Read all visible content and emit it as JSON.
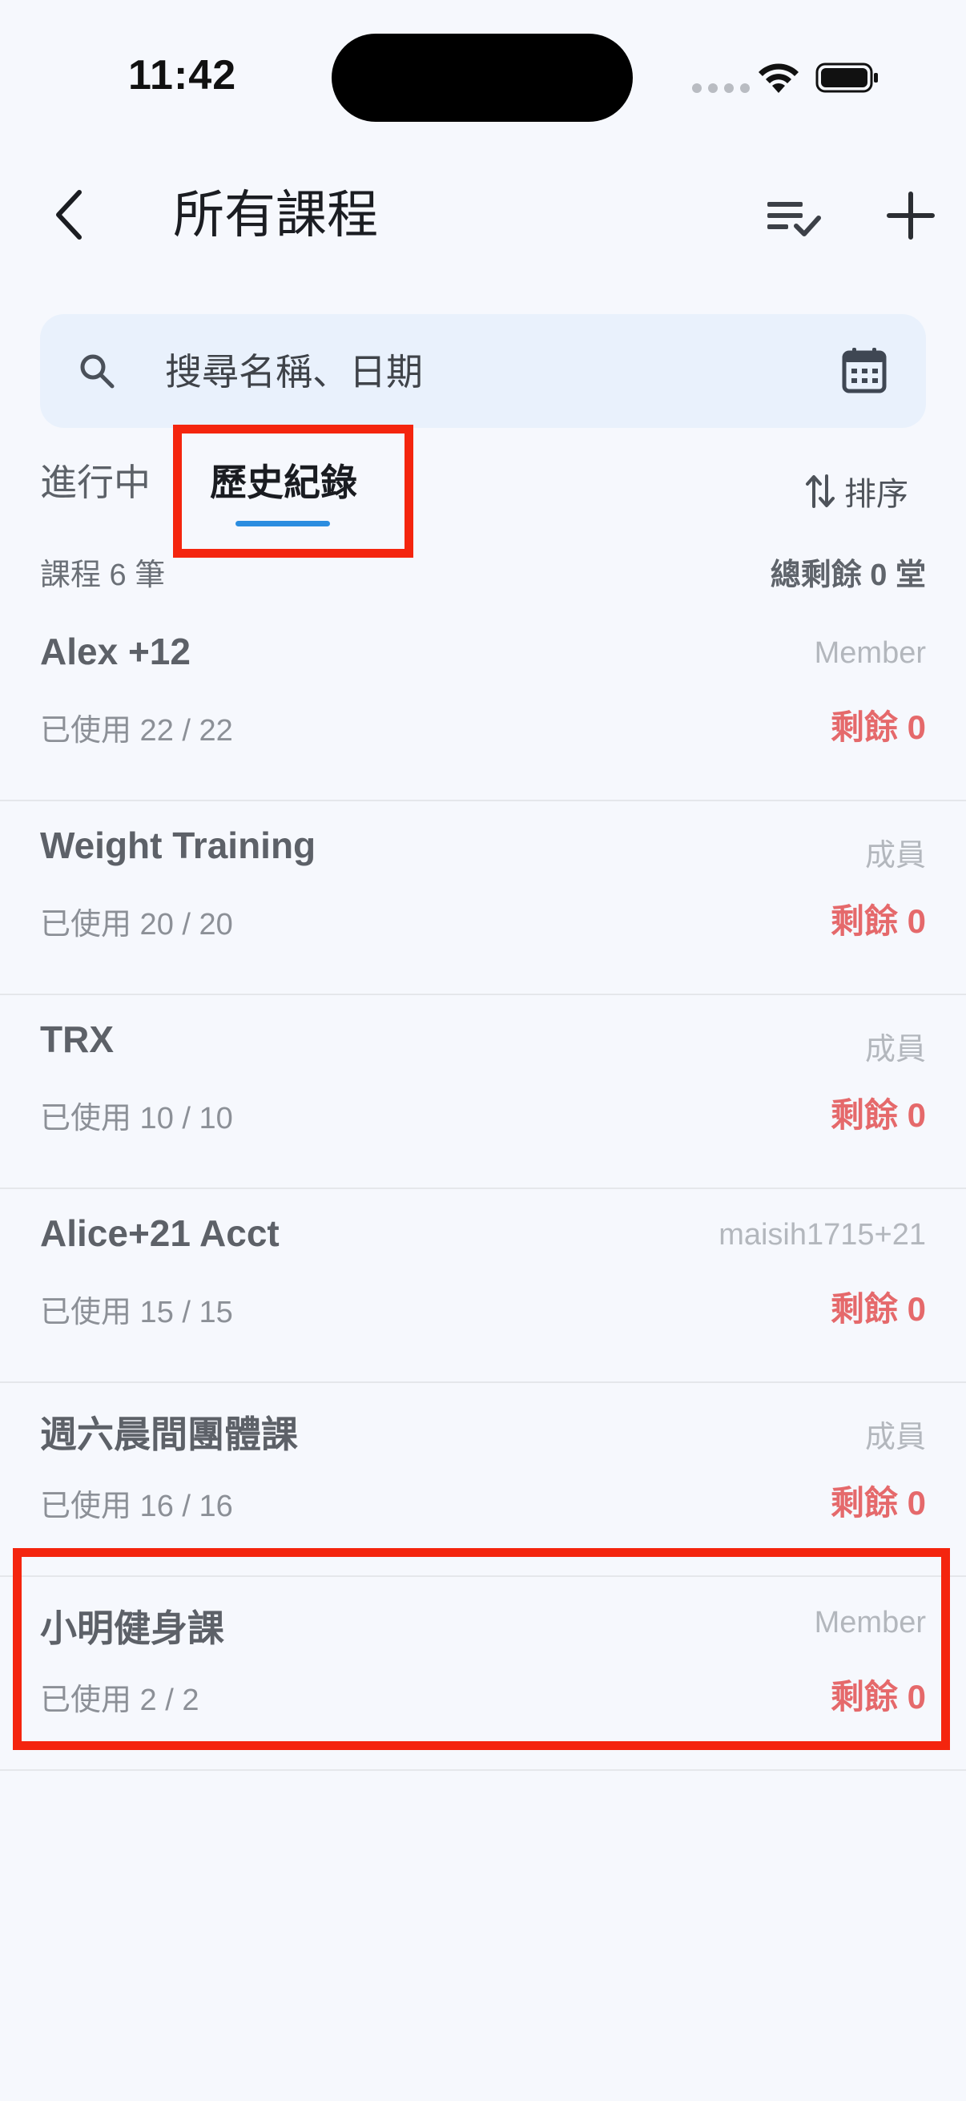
{
  "status_bar": {
    "time": "11:42"
  },
  "header": {
    "title": "所有課程"
  },
  "search": {
    "placeholder": "搜尋名稱、日期"
  },
  "tabs": [
    {
      "label": "進行中",
      "active": false
    },
    {
      "label": "歷史紀錄",
      "active": true
    }
  ],
  "sort": {
    "label": "排序"
  },
  "summary": {
    "count": "課程 6 筆",
    "total": "總剩餘 0 堂"
  },
  "courses": [
    {
      "name": "Alex +12",
      "role": "Member",
      "used": "已使用 22 / 22",
      "remaining": "剩餘 0"
    },
    {
      "name": "Weight Training",
      "role": "成員",
      "used": "已使用 20 / 20",
      "remaining": "剩餘 0"
    },
    {
      "name": "TRX",
      "role": "成員",
      "used": "已使用 10 / 10",
      "remaining": "剩餘 0"
    },
    {
      "name": "Alice+21 Acct",
      "role": "maisih1715+21",
      "used": "已使用 15 / 15",
      "remaining": "剩餘 0"
    },
    {
      "name": "週六晨間團體課",
      "role": "成員",
      "used": "已使用 16 / 16",
      "remaining": "剩餘 0"
    },
    {
      "name": "小明健身課",
      "role": "Member",
      "used": "已使用 2 / 2",
      "remaining": "剩餘 0"
    }
  ],
  "colors": {
    "accent": "#2b8de0",
    "remaining": "#e5696b",
    "highlight": "#f4250e",
    "search_bg": "#e9f1fc",
    "page_bg": "#f6f8fd"
  }
}
